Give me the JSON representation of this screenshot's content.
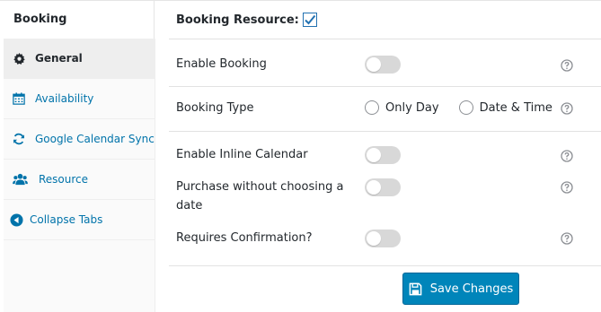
{
  "header": {
    "tab_label": "Booking",
    "booking_resource_label": "Booking Resource:",
    "booking_resource_checked": true
  },
  "sidebar": {
    "items": [
      {
        "label": "General",
        "icon": "gear-icon",
        "active": true
      },
      {
        "label": "Availability",
        "icon": "calendar-icon",
        "active": false
      },
      {
        "label": "Google Calendar Sync",
        "icon": "sync-icon",
        "active": false
      },
      {
        "label": "Resource",
        "icon": "users-icon",
        "active": false
      },
      {
        "label": "Collapse Tabs",
        "icon": "collapse-left-icon",
        "active": false
      }
    ]
  },
  "settings": {
    "enable_booking": {
      "label": "Enable Booking",
      "enabled": false
    },
    "booking_type": {
      "label": "Booking Type",
      "options": [
        "Only Day",
        "Date & Time"
      ],
      "selected": null
    },
    "enable_inline_calendar": {
      "label": "Enable Inline Calendar",
      "enabled": false
    },
    "purchase_without_date": {
      "label_line1": "Purchase without choosing a",
      "label_line2": "date",
      "enabled": false
    },
    "requires_confirmation": {
      "label": "Requires Confirmation?",
      "enabled": false
    }
  },
  "actions": {
    "save_label": "Save Changes"
  },
  "colors": {
    "accent": "#0085ba",
    "link": "#0073aa",
    "toggle_off": "#d8d8d8"
  }
}
